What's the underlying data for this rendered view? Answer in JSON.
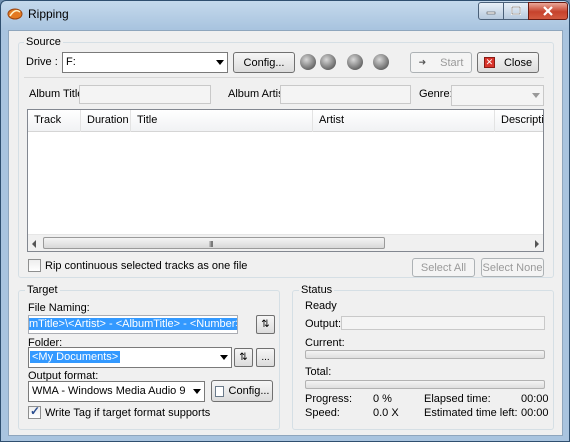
{
  "window": {
    "title": "Ripping",
    "caption_buttons": [
      "minimize",
      "maximize",
      "close"
    ]
  },
  "source": {
    "group_label": "Source",
    "drive_label": "Drive :",
    "drive_value": "F:",
    "config_label": "Config...",
    "start_label": "Start",
    "close_label": "Close",
    "album_title_label": "Album Title:",
    "album_title_value": "",
    "album_artist_label": "Album Artist:",
    "album_artist_value": "",
    "genre_label": "Genre:",
    "genre_value": ""
  },
  "tracks": {
    "columns": [
      "Track",
      "Duration",
      "Title",
      "Artist",
      "Descriptio"
    ],
    "rows": [],
    "scroll_grip": "III"
  },
  "rip_continuous_label": "Rip continuous selected tracks as one file",
  "rip_continuous_checked": false,
  "select_all_label": "Select All",
  "select_none_label": "Select None",
  "target": {
    "group_label": "Target",
    "file_naming_label": "File Naming:",
    "file_naming_value": "mTitle>\\<Artist> - <AlbumTitle> - <Number>. <Title>",
    "folder_label": "Folder:",
    "folder_value": "<My Documents>",
    "browse_label": "...",
    "output_format_label": "Output format:",
    "output_format_value": "WMA - Windows Media Audio 9",
    "config_label": "Config...",
    "write_tag_label": "Write Tag if target format supports",
    "write_tag_checked": true
  },
  "status": {
    "group_label": "Status",
    "state": "Ready",
    "output_label": "Output:",
    "output_value": "",
    "current_label": "Current:",
    "current_fraction": 0,
    "total_label": "Total:",
    "total_fraction": 0,
    "progress_label": "Progress:",
    "progress_value": "0 %",
    "speed_label": "Speed:",
    "speed_value": "0.0 X",
    "elapsed_label": "Elapsed time:",
    "elapsed_value": "00:00",
    "estimated_label": "Estimated time left:",
    "estimated_value": "00:00"
  },
  "icons": {
    "app": "ripping-app-icon",
    "source_buttons": [
      "refresh-disc-icon",
      "eject-disc-icon",
      "cddb-icon",
      "info-icon"
    ]
  },
  "colors": {
    "selection": "#3399ff",
    "close_icon": "#d9342b"
  }
}
